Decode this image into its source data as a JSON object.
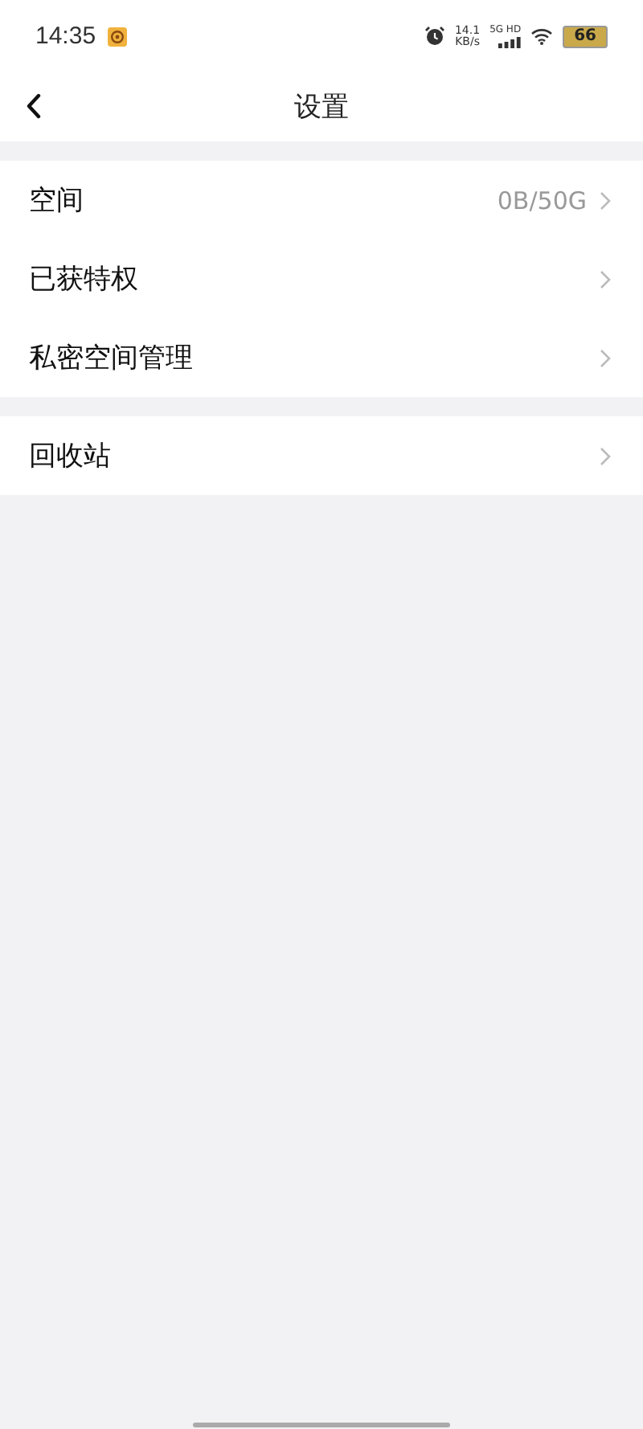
{
  "status_bar": {
    "time": "14:35",
    "net_speed": "14.1",
    "net_unit": "KB/s",
    "network": "5G HD",
    "battery": "66"
  },
  "header": {
    "title": "设置"
  },
  "sections": [
    {
      "items": [
        {
          "label": "空间",
          "value": "0B/50G"
        },
        {
          "label": "已获特权"
        },
        {
          "label": "私密空间管理"
        }
      ]
    },
    {
      "items": [
        {
          "label": "回收站"
        }
      ]
    }
  ]
}
